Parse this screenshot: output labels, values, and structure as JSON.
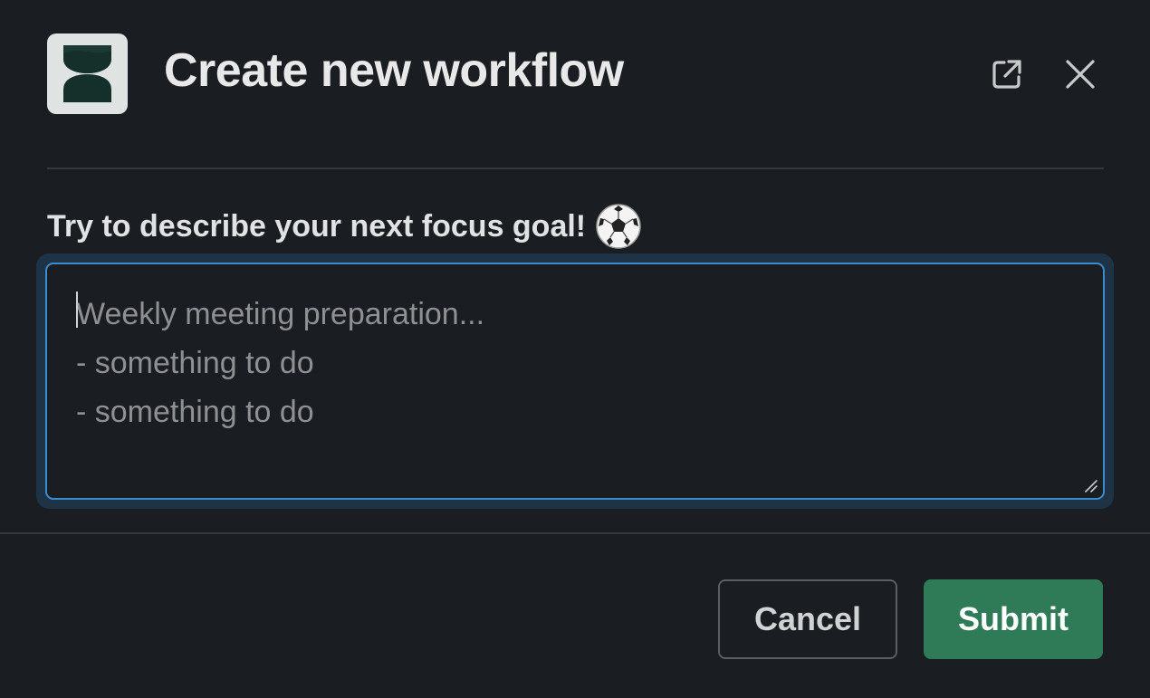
{
  "modal": {
    "title": "Create new workflow",
    "app_icon": "hourglass-icon",
    "header_icons": [
      "external-link-icon",
      "close-icon"
    ]
  },
  "form": {
    "label": "Try to describe your next focus goal!",
    "label_emoji": "soccer-ball-icon",
    "textarea": {
      "value": "",
      "placeholder": "Weekly meeting preparation...\n- something to do\n- something to do",
      "focused": true
    }
  },
  "footer": {
    "cancel_label": "Cancel",
    "submit_label": "Submit"
  },
  "colors": {
    "background": "#1a1d21",
    "focus_border": "#3b8ccd",
    "submit": "#2f7a57"
  }
}
